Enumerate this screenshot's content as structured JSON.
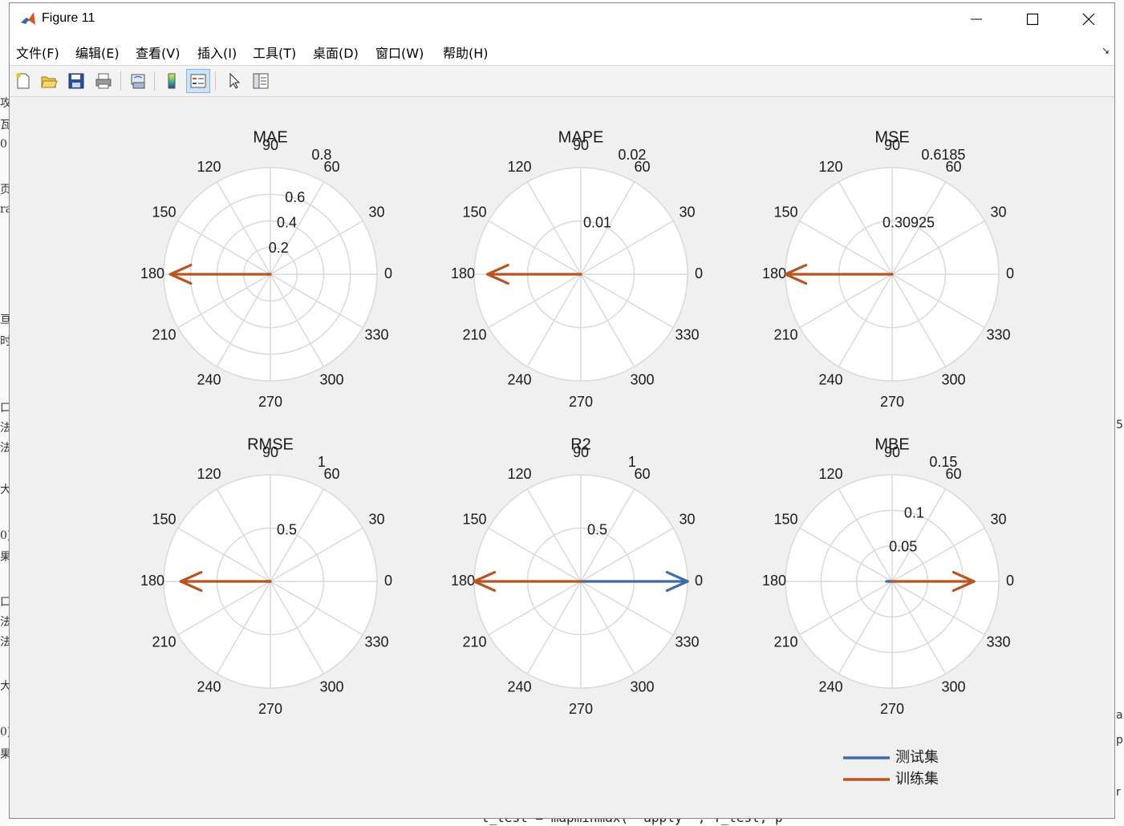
{
  "window": {
    "title": "Figure 11"
  },
  "menu": [
    "文件(F)",
    "编辑(E)",
    "查看(V)",
    "插入(I)",
    "工具(T)",
    "桌面(D)",
    "窗口(W)",
    "帮助(H)"
  ],
  "toolbar": [
    {
      "name": "new-figure-icon"
    },
    {
      "name": "open-file-icon"
    },
    {
      "name": "save-icon"
    },
    {
      "name": "print-icon"
    },
    {
      "name": "link-plot-icon"
    },
    {
      "name": "colorbar-icon"
    },
    {
      "name": "legend-icon"
    },
    {
      "name": "edit-plot-arrow-icon"
    },
    {
      "name": "property-inspector-icon"
    }
  ],
  "colors": {
    "test": "#3e6aa8",
    "train": "#b8541f",
    "grid": "#d9d9d9"
  },
  "background_text": {
    "bottom": "t_test = mapminmax( 'apply' , T_test, p",
    "left": [
      "攻",
      "瓦",
      "0",
      "页",
      "ra",
      "亘",
      "时",
      "口",
      "法",
      "法",
      "大",
      "0)",
      "果",
      "口",
      "法",
      "法",
      "大",
      "0)",
      "果"
    ],
    "right": [
      "5",
      "a",
      "p",
      "r"
    ]
  },
  "chart_data": [
    {
      "type": "compass",
      "title": "MAE",
      "rlim": [
        0,
        0.8
      ],
      "rticks": [
        0.2,
        0.4,
        0.6,
        0.8
      ],
      "series": [
        {
          "name": "测试集",
          "angle_deg": 180,
          "r": 0.02
        },
        {
          "name": "训练集",
          "angle_deg": 180,
          "r": 0.75
        }
      ]
    },
    {
      "type": "compass",
      "title": "MAPE",
      "rlim": [
        0,
        0.02
      ],
      "rticks": [
        0.01,
        0.02
      ],
      "series": [
        {
          "name": "测试集",
          "angle_deg": 180,
          "r": 0.0003
        },
        {
          "name": "训练集",
          "angle_deg": 180,
          "r": 0.0175
        }
      ]
    },
    {
      "type": "compass",
      "title": "MSE",
      "rlim": [
        0,
        0.6185
      ],
      "rticks": [
        0.30925,
        0.6185
      ],
      "series": [
        {
          "name": "测试集",
          "angle_deg": 180,
          "r": 0.005
        },
        {
          "name": "训练集",
          "angle_deg": 180,
          "r": 0.6185
        }
      ]
    },
    {
      "type": "compass",
      "title": "RMSE",
      "rlim": [
        0,
        1
      ],
      "rticks": [
        0.5,
        1
      ],
      "series": [
        {
          "name": "测试集",
          "angle_deg": 180,
          "r": 0.04
        },
        {
          "name": "训练集",
          "angle_deg": 180,
          "r": 0.84
        }
      ]
    },
    {
      "type": "compass",
      "title": "R2",
      "rlim": [
        0,
        1
      ],
      "rticks": [
        0.5,
        1
      ],
      "series": [
        {
          "name": "测试集",
          "angle_deg": 0,
          "r": 1.0
        },
        {
          "name": "训练集",
          "angle_deg": 180,
          "r": 1.0
        }
      ]
    },
    {
      "type": "compass",
      "title": "MBE",
      "rlim": [
        0,
        0.15
      ],
      "rticks": [
        0.05,
        0.1,
        0.15
      ],
      "series": [
        {
          "name": "测试集",
          "angle_deg": 180,
          "r": 0.008
        },
        {
          "name": "训练集",
          "angle_deg": 0,
          "r": 0.115
        }
      ]
    }
  ],
  "angle_labels": [
    "0",
    "30",
    "60",
    "90",
    "120",
    "150",
    "180",
    "210",
    "240",
    "270",
    "300",
    "330"
  ],
  "legend": [
    {
      "label": "测试集",
      "series": "test"
    },
    {
      "label": "训练集",
      "series": "train"
    }
  ]
}
